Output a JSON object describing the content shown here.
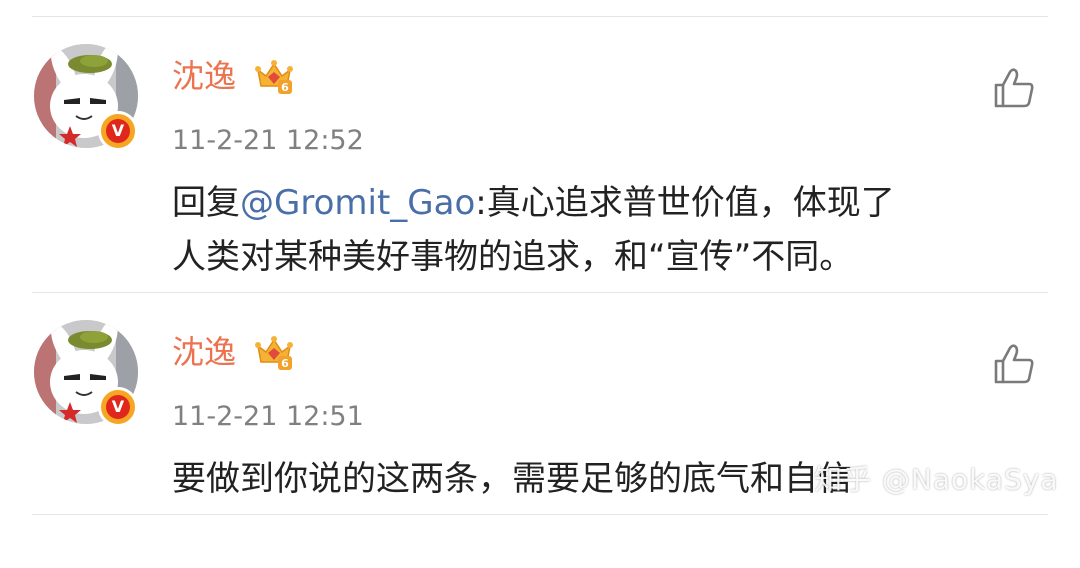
{
  "comments": [
    {
      "username": "沈逸",
      "avatar_icon": "bunny-avatar",
      "verified_icon": "v-badge-icon",
      "verified_label": "V",
      "vip_icon": "crown-vip-icon",
      "vip_level": "6",
      "timestamp": "11-2-21 12:52",
      "like_icon": "thumbs-up-icon",
      "reply_prefix": "回复",
      "mention": "@Gromit_Gao",
      "line1_rest": ":真心追求普世价值，体现了",
      "line2": "人类对某种美好事物的追求，和“宣传”不同。"
    },
    {
      "username": "沈逸",
      "avatar_icon": "bunny-avatar",
      "verified_icon": "v-badge-icon",
      "verified_label": "V",
      "vip_icon": "crown-vip-icon",
      "vip_level": "6",
      "timestamp": "11-2-21 12:51",
      "like_icon": "thumbs-up-icon",
      "line1": "要做到你说的这两条，需要足够的底气和自信"
    }
  ],
  "watermark": "知乎 @NaokaSya",
  "colors": {
    "username": "#eb7350",
    "mention": "#4a6ea8",
    "timestamp": "#808080",
    "text": "#222222",
    "badge_orange": "#f6a623",
    "badge_red": "#e0271b"
  }
}
